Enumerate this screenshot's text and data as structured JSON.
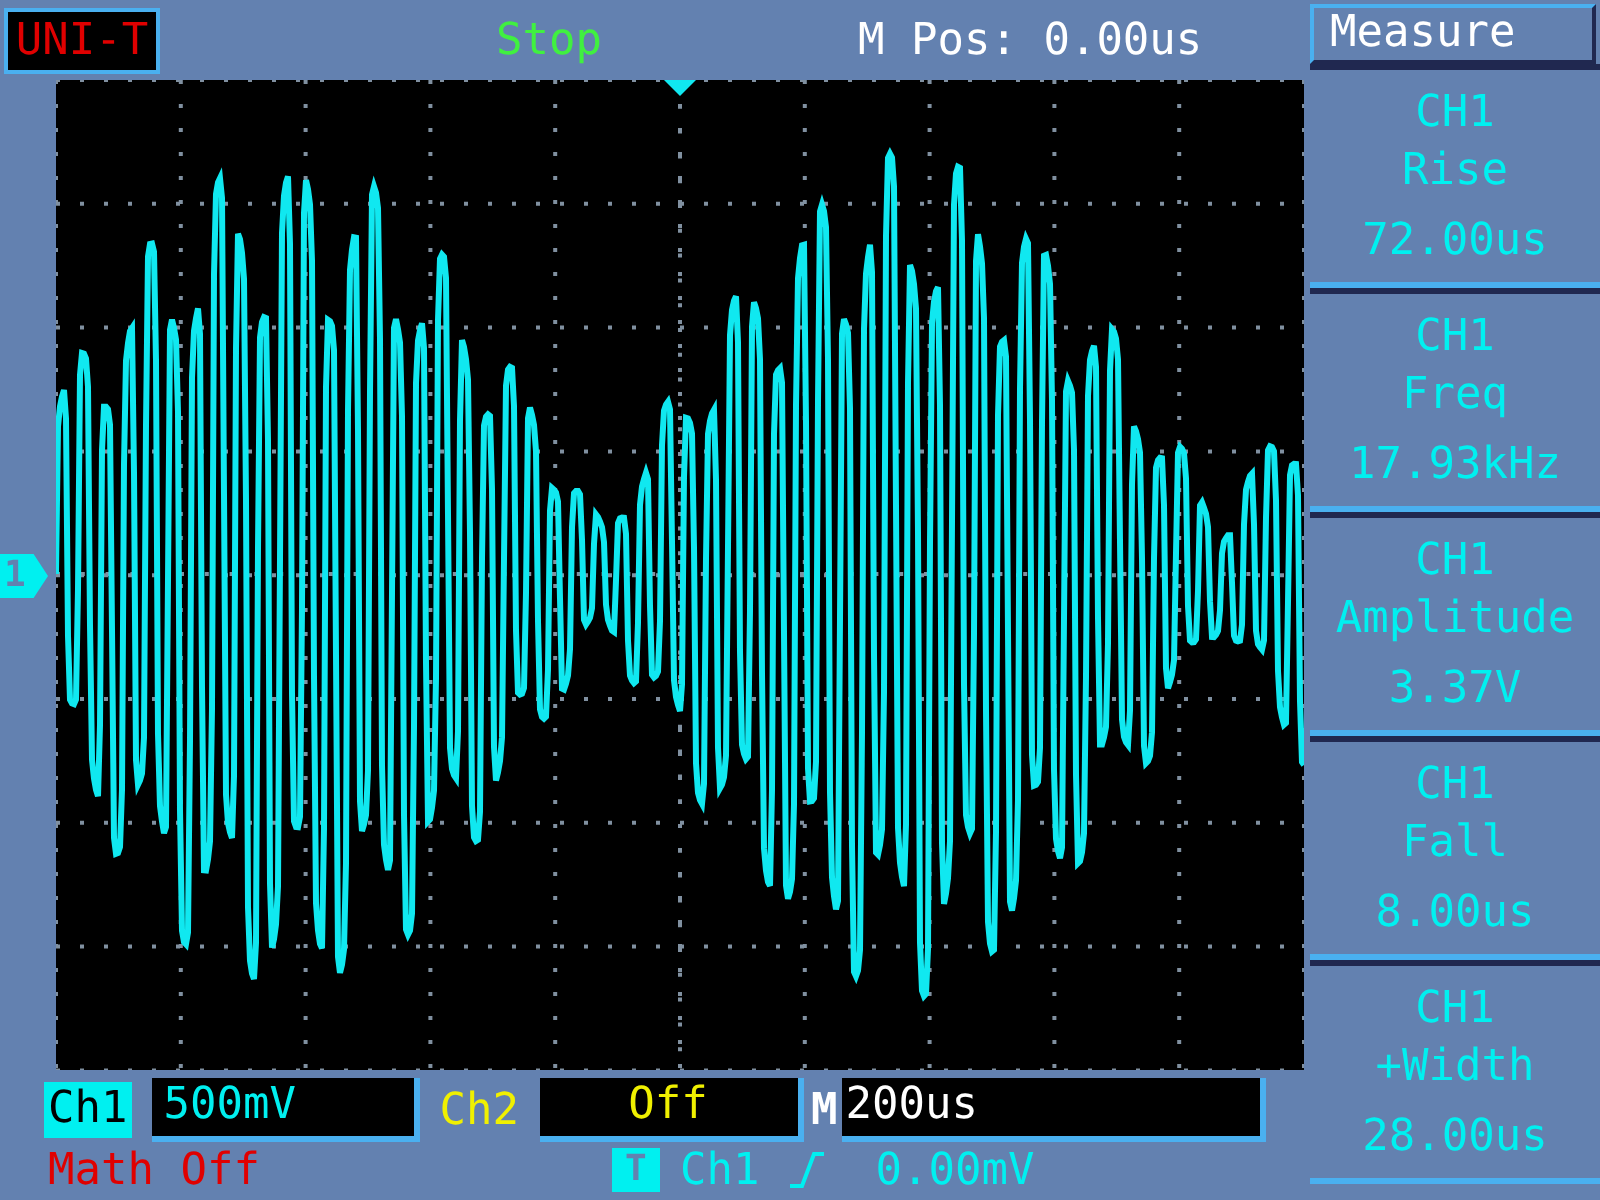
{
  "header": {
    "logo": "UNI-T",
    "run_state": "Stop",
    "m_pos": "M Pos: 0.00us"
  },
  "ch1_marker": "1",
  "measure_panel": {
    "title": "Measure",
    "items": [
      {
        "channel": "CH1",
        "label": "Rise",
        "value": "72.00us"
      },
      {
        "channel": "CH1",
        "label": "Freq",
        "value": "17.93kHz"
      },
      {
        "channel": "CH1",
        "label": "Amplitude",
        "value": "3.37V"
      },
      {
        "channel": "CH1",
        "label": "Fall",
        "value": "8.00us"
      },
      {
        "channel": "CH1",
        "label": "+Width",
        "value": "28.00us"
      }
    ]
  },
  "footer": {
    "ch1": {
      "label": "Ch1",
      "scale": "500mV"
    },
    "ch2": {
      "label": "Ch2",
      "scale": "Off"
    },
    "timebase": {
      "label": "M",
      "value": "200us"
    },
    "math": "Math Off",
    "trigger": {
      "badge": "T",
      "source": "Ch1",
      "level": "0.00mV"
    }
  }
}
